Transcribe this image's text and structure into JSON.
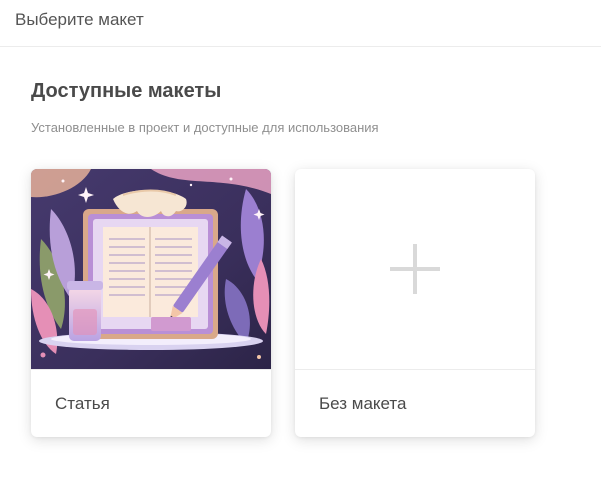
{
  "header": {
    "title": "Выберите макет"
  },
  "section": {
    "title": "Доступные макеты",
    "subtitle": "Установленные в проект и доступные для использования"
  },
  "cards": [
    {
      "label": "Статья",
      "icon": "notebook-illustration"
    },
    {
      "label": "Без макета",
      "icon": "plus-icon"
    }
  ],
  "colors": {
    "illustration_bg": "#3a2f5c",
    "accent_pink": "#e9a2c3",
    "accent_purple": "#9b7fd0",
    "plus": "#d9d9d9"
  }
}
